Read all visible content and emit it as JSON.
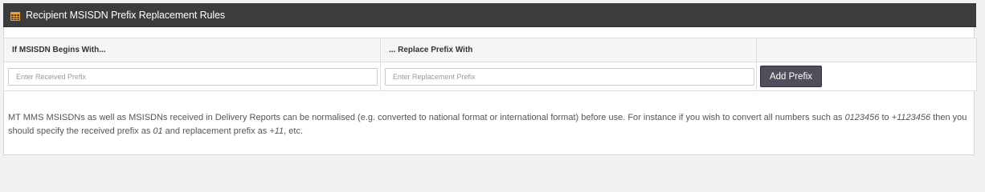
{
  "panel": {
    "title": "Recipient MSISDN Prefix Replacement Rules",
    "icon": "table-icon",
    "icon_color": "#f0a030",
    "header_bg": "#3c3c3c"
  },
  "table": {
    "columns": [
      "If MSISDN Begins With...",
      "... Replace Prefix With",
      ""
    ],
    "received_prefix": {
      "value": "",
      "placeholder": "Enter Received Prefix"
    },
    "replacement_prefix": {
      "value": "",
      "placeholder": "Enter Replacement Prefix"
    },
    "add_button_label": "Add Prefix"
  },
  "help": {
    "part1": "MT MMS MSISDNs as well as MSISDNs received in Delivery Reports can be normalised (e.g. converted to national format or international format) before use. For instance if you wish to convert all numbers such as ",
    "example_number": "0123456",
    "part2": " to ",
    "example_converted": "+1123456",
    "part3": " then you should specify the received prefix as ",
    "example_received": "01",
    "part4": " and replacement prefix as ",
    "example_replacement": "+11",
    "part5": ", etc."
  }
}
